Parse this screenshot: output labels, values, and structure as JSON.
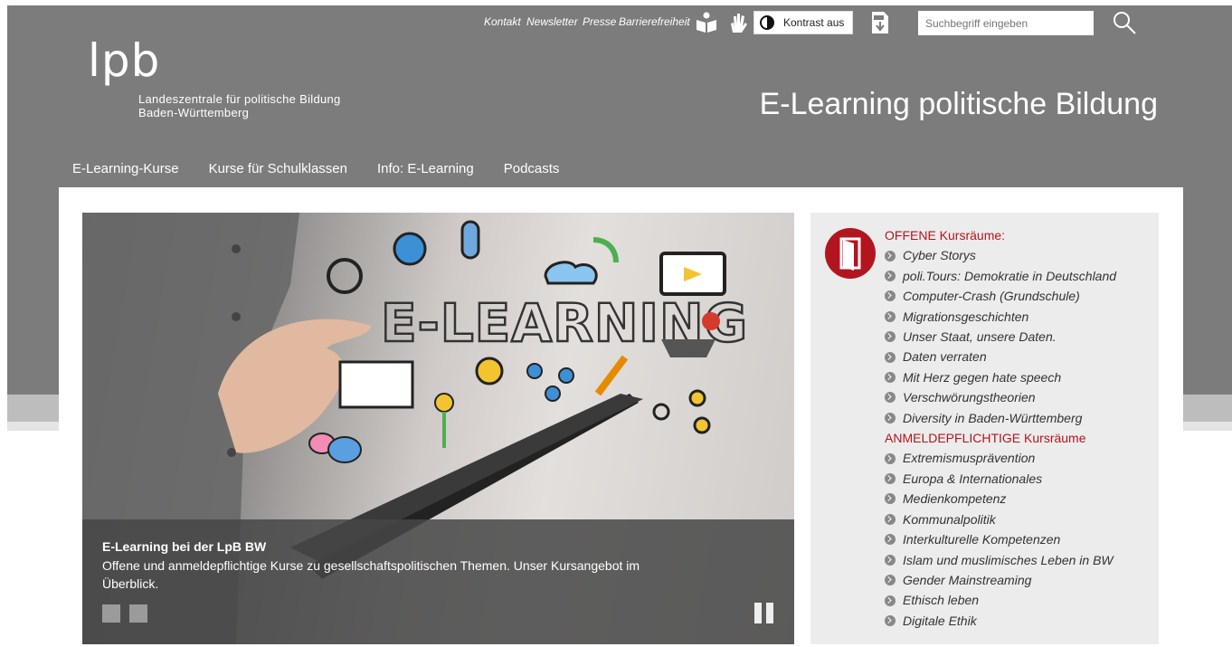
{
  "topbar": {
    "links": [
      "Kontakt",
      "Newsletter",
      "Presse",
      "Barrierefreiheit"
    ],
    "icons": [
      "easy-language-icon",
      "sign-language-icon",
      "pdf-download-icon"
    ],
    "contrast_label": "Kontrast aus",
    "search_placeholder": "Suchbegriff eingeben"
  },
  "logo": {
    "mark": "lpb",
    "line1": "Landeszentrale für politische Bildung",
    "line2": "Baden-Württemberg"
  },
  "site_title": "E-Learning politische Bildung",
  "nav": [
    "E-Learning-Kurse",
    "Kurse für Schulklassen",
    "Info: E-Learning",
    "Podcasts"
  ],
  "hero": {
    "image_text": "E-LEARNING",
    "caption_title": "E-Learning bei der LpB BW",
    "caption_text": "Offene und anmeldepflichtige Kurse zu gesellschaftspolitischen Themen. Unser Kursangebot im Überblick.",
    "slide_count": 2
  },
  "sidebar": {
    "open_heading": "OFFENE Kursräume:",
    "open_items": [
      "Cyber Storys",
      "poli.Tours: Demokratie in Deutschland",
      "Computer-Crash (Grundschule)",
      "Migrationsgeschichten",
      "Unser Staat, unsere Daten.",
      "Daten verraten",
      "Mit Herz gegen hate speech",
      "Verschwörungstheorien",
      "Diversity in Baden-Württemberg"
    ],
    "reg_heading": "ANMELDEPFLICHTIGE Kursräume",
    "reg_items": [
      "Extremismusprävention",
      "Europa & Internationales",
      "Medienkompetenz",
      "Kommunalpolitik",
      "Interkulturelle Kompetenzen",
      "Islam und muslimisches Leben in BW",
      "Gender Mainstreaming",
      "Ethisch leben",
      "Digitale Ethik"
    ]
  },
  "colors": {
    "header": "#7c7c7c",
    "accent_red": "#b3151f",
    "sidebar_bg": "#ececec"
  }
}
